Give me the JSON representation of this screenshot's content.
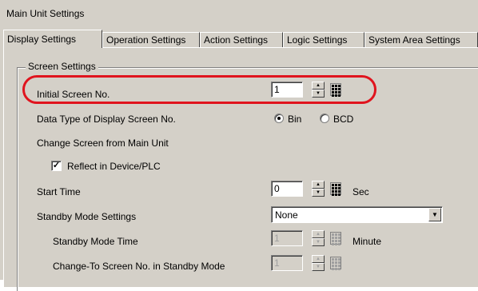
{
  "window": {
    "title": "Main Unit Settings"
  },
  "tabs": [
    {
      "label": "Display Settings"
    },
    {
      "label": "Operation Settings"
    },
    {
      "label": "Action Settings"
    },
    {
      "label": "Logic Settings"
    },
    {
      "label": "System Area Settings"
    }
  ],
  "screen_settings": {
    "group_label": "Screen Settings",
    "initial_screen": {
      "label": "Initial Screen No.",
      "value": "1"
    },
    "data_type": {
      "label": "Data Type of Display Screen No.",
      "options": [
        "Bin",
        "BCD"
      ],
      "selected": "Bin"
    },
    "change_screen": {
      "label": "Change Screen from Main Unit"
    },
    "reflect": {
      "label": "Reflect in Device/PLC",
      "checked": true
    },
    "start_time": {
      "label": "Start Time",
      "value": "0",
      "unit": "Sec"
    },
    "standby_mode": {
      "label": "Standby Mode Settings",
      "value": "None"
    },
    "standby_time": {
      "label": "Standby Mode Time",
      "value": "1",
      "unit": "Minute"
    },
    "change_to_screen": {
      "label": "Change-To Screen No. in Standby Mode",
      "value": "1"
    }
  },
  "colors": {
    "highlight": "#e0141e",
    "window_bg": "#d4d0c8"
  },
  "icons": {
    "spin": "spin-arrows-icon",
    "keypad": "keypad-icon",
    "dropdown": "chevron-down-icon",
    "check": "check-icon"
  }
}
